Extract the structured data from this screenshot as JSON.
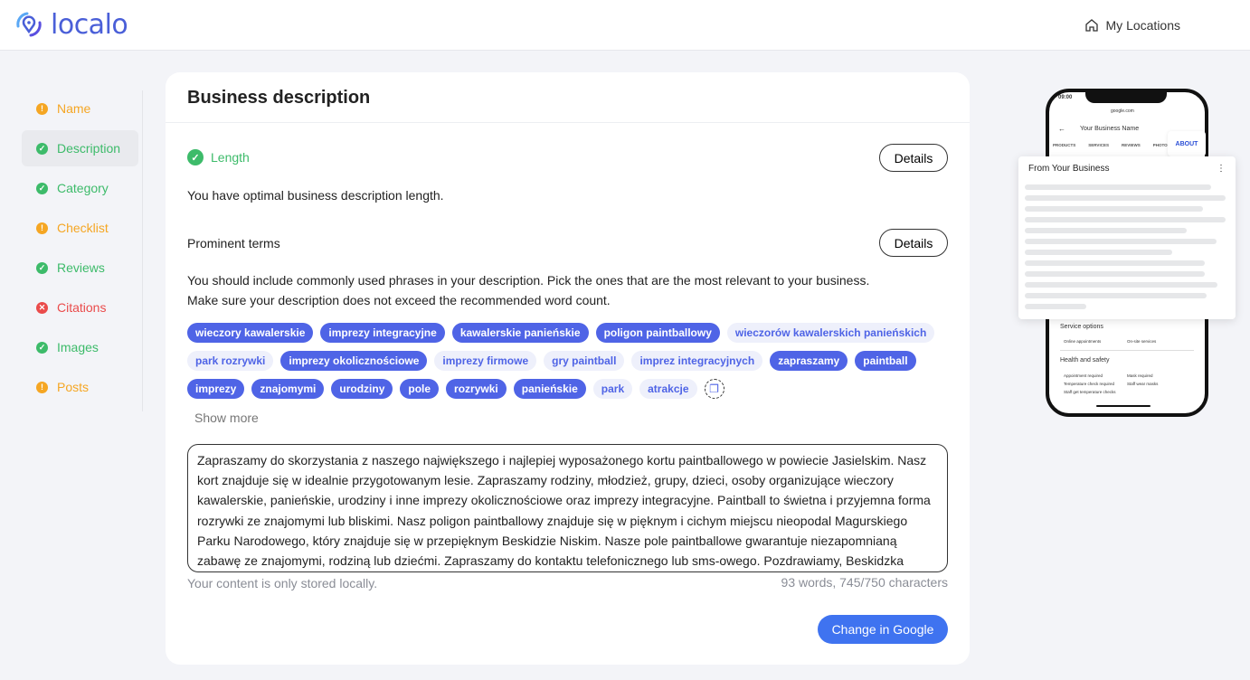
{
  "header": {
    "logo": "localo",
    "my_locations": "My Locations"
  },
  "sidebar": {
    "items": [
      {
        "label": "Name",
        "status": "warning"
      },
      {
        "label": "Description",
        "status": "ok",
        "active": true
      },
      {
        "label": "Category",
        "status": "ok"
      },
      {
        "label": "Checklist",
        "status": "warning"
      },
      {
        "label": "Reviews",
        "status": "ok"
      },
      {
        "label": "Citations",
        "status": "error"
      },
      {
        "label": "Images",
        "status": "ok"
      },
      {
        "label": "Posts",
        "status": "warning"
      }
    ]
  },
  "colors": {
    "warning": "#f5a623",
    "ok": "#3dbb6a",
    "error": "#ea4b4b",
    "accent": "#4f64e6",
    "button": "#3f73f0"
  },
  "card": {
    "title": "Business description",
    "length": {
      "label": "Length",
      "text": "You have optimal business description length.",
      "details": "Details"
    },
    "prominent": {
      "label": "Prominent terms",
      "details": "Details",
      "text1": "You should include commonly used phrases in your description. Pick the ones that are the most relevant to your business.",
      "text2": "Make sure your description does not exceed the recommended word count."
    },
    "tags": [
      {
        "t": "wieczory kawalerskie",
        "on": true
      },
      {
        "t": "imprezy integracyjne",
        "on": true
      },
      {
        "t": "kawalerskie panieńskie",
        "on": true
      },
      {
        "t": "poligon paintballowy",
        "on": true
      },
      {
        "t": "wieczorów kawalerskich panieńskich",
        "on": false
      },
      {
        "t": "park rozrywki",
        "on": false
      },
      {
        "t": "imprezy okolicznościowe",
        "on": true
      },
      {
        "t": "imprezy firmowe",
        "on": false
      },
      {
        "t": "gry paintball",
        "on": false
      },
      {
        "t": "imprez integracyjnych",
        "on": false
      },
      {
        "t": "zapraszamy",
        "on": true
      },
      {
        "t": "paintball",
        "on": true
      },
      {
        "t": "imprezy",
        "on": true
      },
      {
        "t": "znajomymi",
        "on": true
      },
      {
        "t": "urodziny",
        "on": true
      },
      {
        "t": "pole",
        "on": true
      },
      {
        "t": "rozrywki",
        "on": true
      },
      {
        "t": "panieńskie",
        "on": true
      },
      {
        "t": "park",
        "on": false
      },
      {
        "t": "atrakcje",
        "on": false
      }
    ],
    "show_more": "Show more",
    "description": "Zapraszamy do skorzystania z naszego największego i najlepiej wyposażonego kortu paintballowego w powiecie Jasielskim. Nasz kort znajduje się w idealnie przygotowanym lesie. Zapraszamy rodziny, młodzież, grupy, dzieci, osoby organizujące wieczory kawalerskie, panieńskie, urodziny i inne imprezy okolicznościowe oraz imprezy integracyjne. Paintball to świetna i przyjemna forma rozrywki ze znajomymi lub bliskimi. Nasz poligon paintballowy znajduje się w pięknym i cichym miejscu nieopodal Magurskiego Parku Narodowego, który znajduje się w przepięknym Beskidzie Niskim. Nasze pole paintballowe gwarantuje niezapomnianą zabawę ze znajomymi, rodziną lub dziećmi. Zapraszamy do kontaktu telefonicznego lub sms-owego. Pozdrawiamy, Beskidzka",
    "storage_note": "Your content is only stored locally.",
    "counts": "93 words, 745/750 characters",
    "change_button": "Change in Google"
  },
  "phone": {
    "time": "09:00",
    "url": "google.com",
    "business_name": "Your Business Name",
    "tabs": [
      "PRODUCTS",
      "SERVICES",
      "REVIEWS",
      "PHOTOS"
    ],
    "about": "ABOUT",
    "popup_title": "From Your Business",
    "service_options": "Service options",
    "service_items": [
      "Online appointments",
      "On-site services"
    ],
    "health": "Health and safety",
    "health_items": [
      "Appointment required",
      "Mask required",
      "Temperature check required",
      "Staff wear masks",
      "Staff get temperature checks"
    ]
  }
}
